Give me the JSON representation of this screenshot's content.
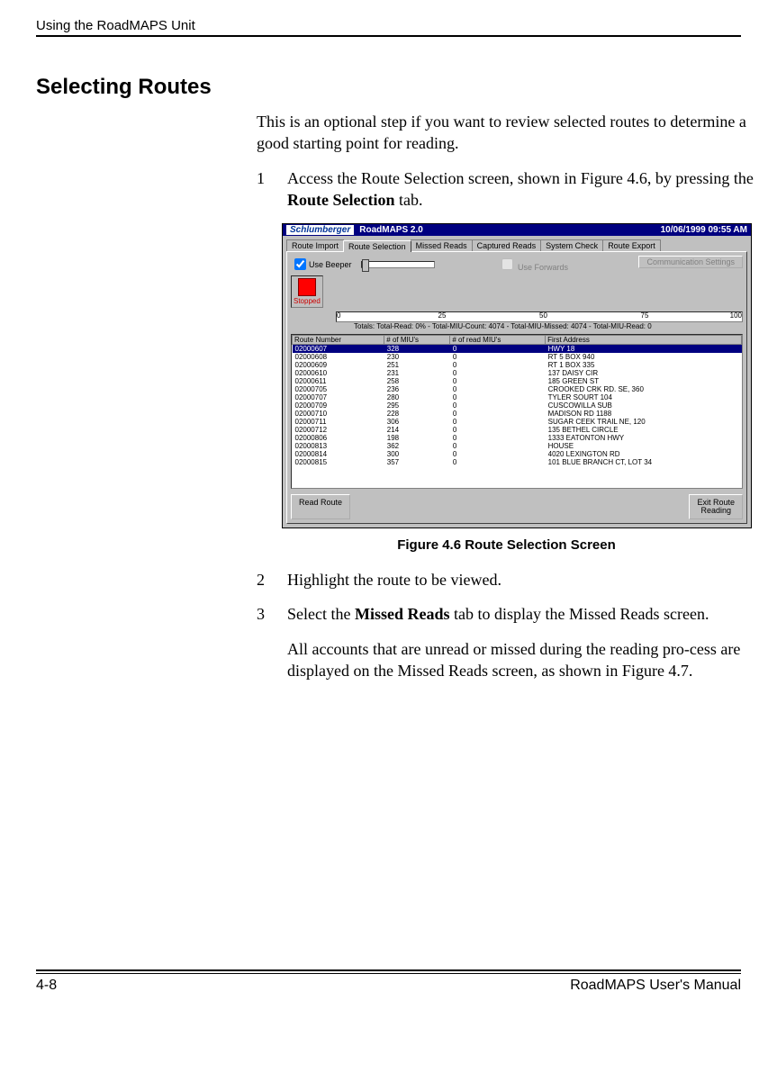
{
  "header": {
    "running_head": "Using the RoadMAPS Unit"
  },
  "section": {
    "title": "Selecting Routes"
  },
  "intro": "This is an optional step if you want to review selected routes to determine a good starting point for reading.",
  "steps": {
    "s1_num": "1",
    "s1_a": "Access the Route Selection screen, shown in Figure 4.6, by pressing the ",
    "s1_b": "Route Selection",
    "s1_c": " tab.",
    "s2_num": "2",
    "s2": "Highlight the route to be viewed.",
    "s3_num": "3",
    "s3_a": "Select the ",
    "s3_b": "Missed Reads",
    "s3_c": " tab to display the Missed Reads screen.",
    "s3_follow": "All accounts that are unread or missed during the reading pro-cess are displayed on the Missed Reads screen, as shown in Figure 4.7."
  },
  "figure": {
    "caption": "Figure 4.6   Route Selection Screen"
  },
  "screenshot": {
    "brand": "Schlumberger",
    "app_title": "RoadMAPS 2.0",
    "timestamp": "10/06/1999 09:55 AM",
    "tabs": [
      "Route Import",
      "Route Selection",
      "Missed Reads",
      "Captured Reads",
      "System Check",
      "Route Export"
    ],
    "use_beeper": "Use Beeper",
    "use_fwd": "Use Forwards",
    "comm_btn": "Communication Settings",
    "stopped": "Stopped",
    "ticks": {
      "t0": "0",
      "t25": "25",
      "t50": "50",
      "t75": "75",
      "t100": "100"
    },
    "totals_label": "Totals:",
    "totals": "Total-Read: 0%  -  Total-MIU-Count: 4074  -  Total-MIU-Missed: 4074  -  Total-MIU-Read: 0",
    "cols": [
      "Route Number",
      "# of MIU's",
      "# of read MIU's",
      "First Address"
    ],
    "rows": [
      [
        "02000607",
        "328",
        "0",
        "HWY 18"
      ],
      [
        "02000608",
        "230",
        "0",
        "RT 5 BOX 940"
      ],
      [
        "02000609",
        "251",
        "0",
        "RT 1 BOX 335"
      ],
      [
        "02000610",
        "231",
        "0",
        "137 DAISY CIR"
      ],
      [
        "02000611",
        "258",
        "0",
        "185 GREEN ST"
      ],
      [
        "02000705",
        "236",
        "0",
        "CROOKED CRK RD. SE, 360"
      ],
      [
        "02000707",
        "280",
        "0",
        "TYLER SOURT 104"
      ],
      [
        "02000709",
        "295",
        "0",
        "CUSCOWILLA SUB"
      ],
      [
        "02000710",
        "228",
        "0",
        "MADISON RD 1188"
      ],
      [
        "02000711",
        "306",
        "0",
        "SUGAR CEEK TRAIL NE, 120"
      ],
      [
        "02000712",
        "214",
        "0",
        "135 BETHEL CIRCLE"
      ],
      [
        "02000806",
        "198",
        "0",
        "1333 EATONTON HWY"
      ],
      [
        "02000813",
        "362",
        "0",
        "HOUSE"
      ],
      [
        "02000814",
        "300",
        "0",
        "4020 LEXINGTON RD"
      ],
      [
        "02000815",
        "357",
        "0",
        "101 BLUE BRANCH CT, LOT 34"
      ]
    ],
    "btn_read": "Read Route",
    "btn_exit_l1": "Exit Route",
    "btn_exit_l2": "Reading"
  },
  "footer": {
    "left": "4-8",
    "right": "RoadMAPS User's Manual"
  }
}
